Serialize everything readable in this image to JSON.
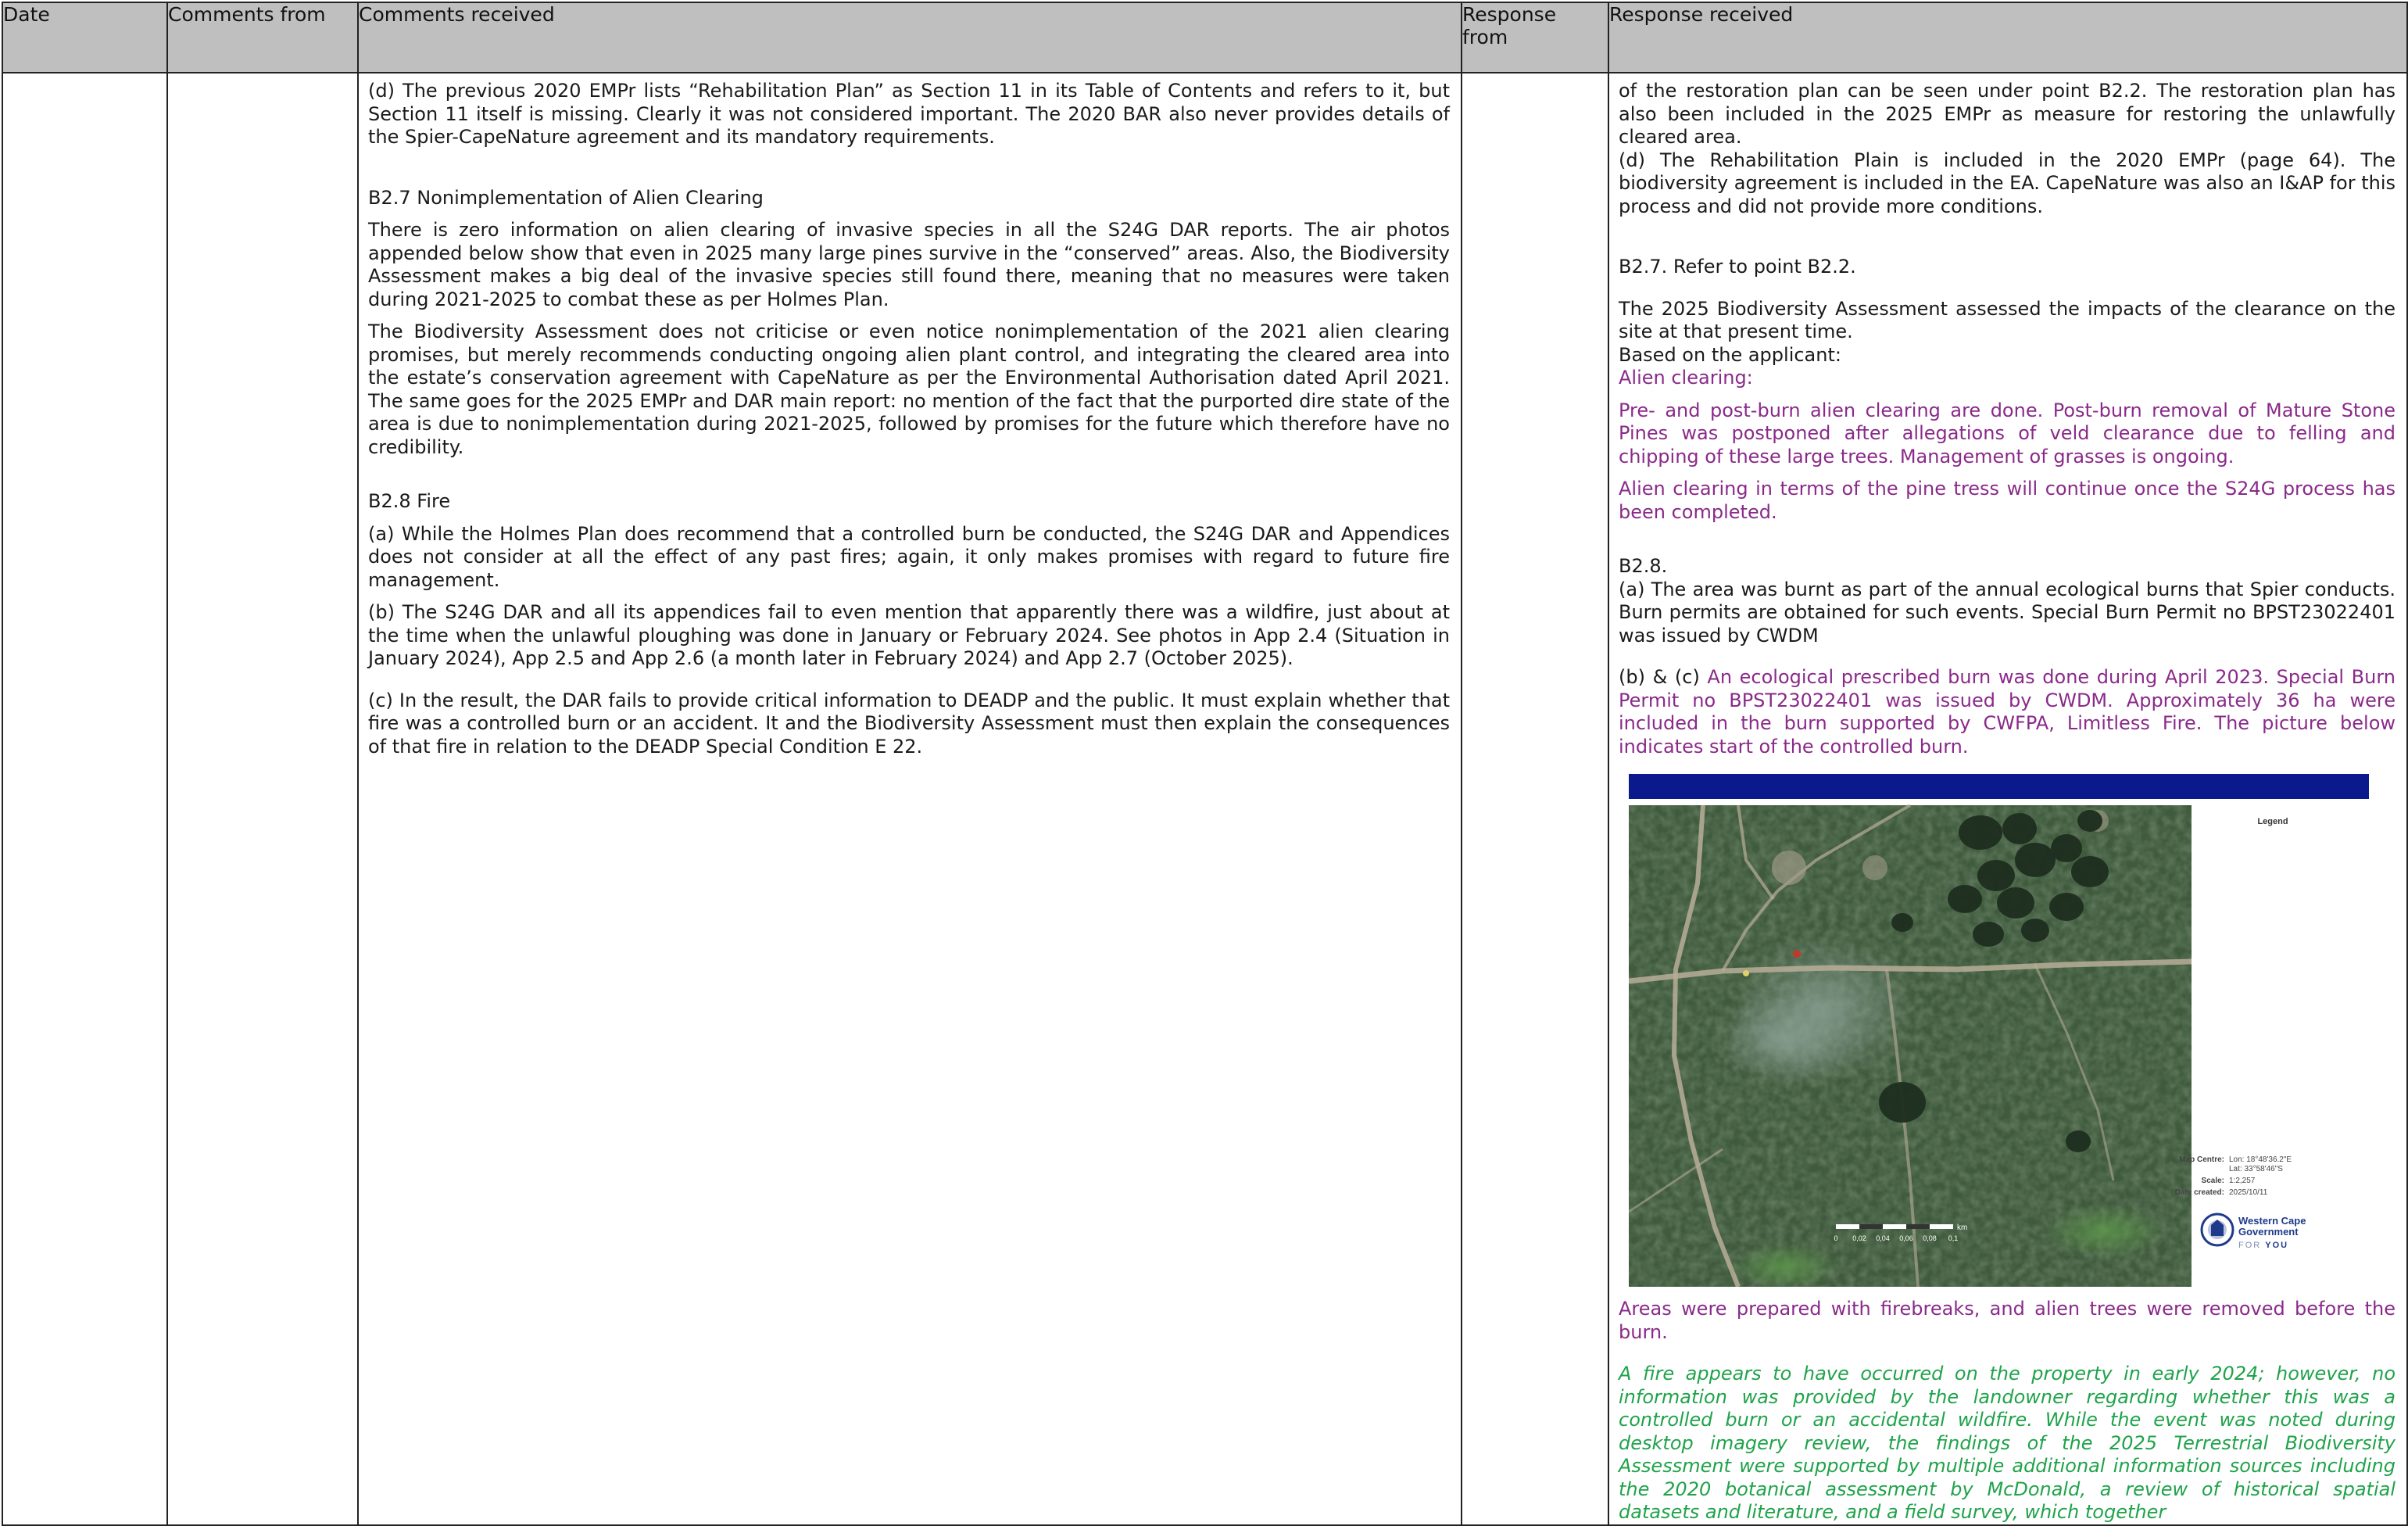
{
  "headers": {
    "date": "Date",
    "comments_from": "Comments from",
    "comments_received": "Comments received",
    "response_from": "Response from",
    "response_received": "Response received"
  },
  "comments": {
    "p1": "(d) The previous 2020 EMPr lists “Rehabilitation Plan” as Section 11 in its Table of Contents and refers to it, but Section 11 itself is missing. Clearly it was not considered important. The 2020 BAR also never provides details of the Spier-CapeNature agreement and its mandatory requirements.",
    "b27_heading": "B2.7 Nonimplementation of Alien Clearing",
    "b27_p1": "There is zero information on alien clearing of invasive species in all the S24G DAR reports. The air photos appended below show that even in 2025 many large pines survive in the “conserved” areas. Also, the Biodiversity Assessment makes a big deal of the invasive species still found there, meaning that no measures were taken during 2021-2025 to combat these as per Holmes Plan.",
    "b27_p2": "The Biodiversity Assessment does not criticise or even notice nonimplementation of the 2021 alien clearing promises, but merely recommends conducting ongoing alien plant control, and integrating the cleared area into the estate’s conservation agreement with CapeNature as per the Environmental Authorisation dated April 2021. The same goes for the 2025 EMPr and DAR main report: no mention of the fact that the purported dire state of the area is due to nonimplementation during 2021-2025, followed by promises for the future which therefore have no credibility.",
    "b28_heading": "B2.8 Fire",
    "b28_a": "(a) While the Holmes Plan does recommend that a controlled burn be conducted, the S24G DAR and Appendices does not consider at all the effect of any past fires; again, it only makes promises with regard to future fire management.",
    "b28_b": "(b) The S24G DAR and all its appendices fail to even mention that apparently there was a wildfire, just about at the time when the unlawful ploughing was done in January or February 2024. See photos in App 2.4 (Situation in January 2024), App 2.5 and App 2.6 (a month later in February 2024) and App 2.7 (October 2025).",
    "b28_c": "(c) In the result, the DAR fails to provide critical information to DEADP and the public. It must explain whether that fire was a controlled burn or an accident. It and the Biodiversity Assessment must then explain the consequences of that fire in relation to the DEADP Special Condition E 22."
  },
  "response": {
    "p1": "of the restoration plan can be seen under point B2.2. The restoration plan has also been included in the 2025 EMPr as measure for restoring the unlawfully cleared area.",
    "p2": "(d) The Rehabilitation Plain is included in the 2020 EMPr (page 64). The biodiversity agreement is included in the EA. CapeNature was also an I&AP for this process and did not provide more conditions.",
    "b27": "B2.7. Refer to point B2.2.",
    "assess": "The 2025 Biodiversity Assessment assessed the impacts of the clearance on the site at that present time.",
    "based": "Based on the applicant:",
    "alien_label": "Alien clearing:",
    "pre_post": "Pre- and post-burn alien clearing are done. Post-burn removal of Mature Stone Pines was postponed after allegations of veld clearance due to felling and chipping of these large trees. Management of grasses is ongoing.",
    "pine": "Alien clearing in terms of the pine tress will continue once the S24G process has been completed.",
    "b28": "B2.8.",
    "b28_a": "(a) The area was burnt as part of the annual ecological burns that Spier conducts. Burn permits are obtained for such events. Special Burn Permit no BPST23022401 was issued by CWDM",
    "b28_bc_prefix": "(b) & (c) ",
    "b28_bc_text": "An ecological prescribed burn was done during April 2023. Special Burn Permit no BPST23022401 was issued by CWDM. Approximately 36 ha were included in the burn supported by CWFPA, Limitless Fire. The picture below indicates start of the controlled burn.",
    "areas": "Areas were prepared with firebreaks, and alien trees were removed before the burn.",
    "green": "A fire appears to have occurred on the property in early 2024; however, no information was provided by the landowner regarding whether this was a controlled burn or an accidental wildfire. While the event was noted during desktop imagery review, the findings of the 2025 Terrestrial Biodiversity Assessment were supported by multiple additional information sources including the 2020 botanical assessment by McDonald, a review of historical spatial datasets and literature, and a field survey, which together"
  },
  "map": {
    "legend_title": "Legend",
    "map_centre_label": "Map Centre:",
    "lon": "Lon: 18°48'36.2\"E",
    "lat": "Lat: 33°58'46\"S",
    "scale_label": "Scale:",
    "scale_value": "1:2,257",
    "date_label": "Date created:",
    "date_value": "2025/10/11",
    "logo_line1": "Western Cape",
    "logo_line2": "Government",
    "logo_line3_a": "FOR ",
    "logo_line3_b": "YOU",
    "scalebar_unit": "km",
    "scalebar_ticks": [
      "0",
      "0,02",
      "0,04",
      "0,06",
      "0,08",
      "0,1"
    ],
    "colors": {
      "header_bar": "#0a1a8c",
      "vegetation": "#3f5a3c",
      "trees": "#1e2e1f",
      "track": "#b8ae98",
      "logo": "#1f3a8a"
    }
  },
  "colors": {
    "header_bg": "#bfbfbf",
    "purple_text": "#8a2a8a",
    "green_text": "#1fa34a",
    "border": "#222222"
  }
}
